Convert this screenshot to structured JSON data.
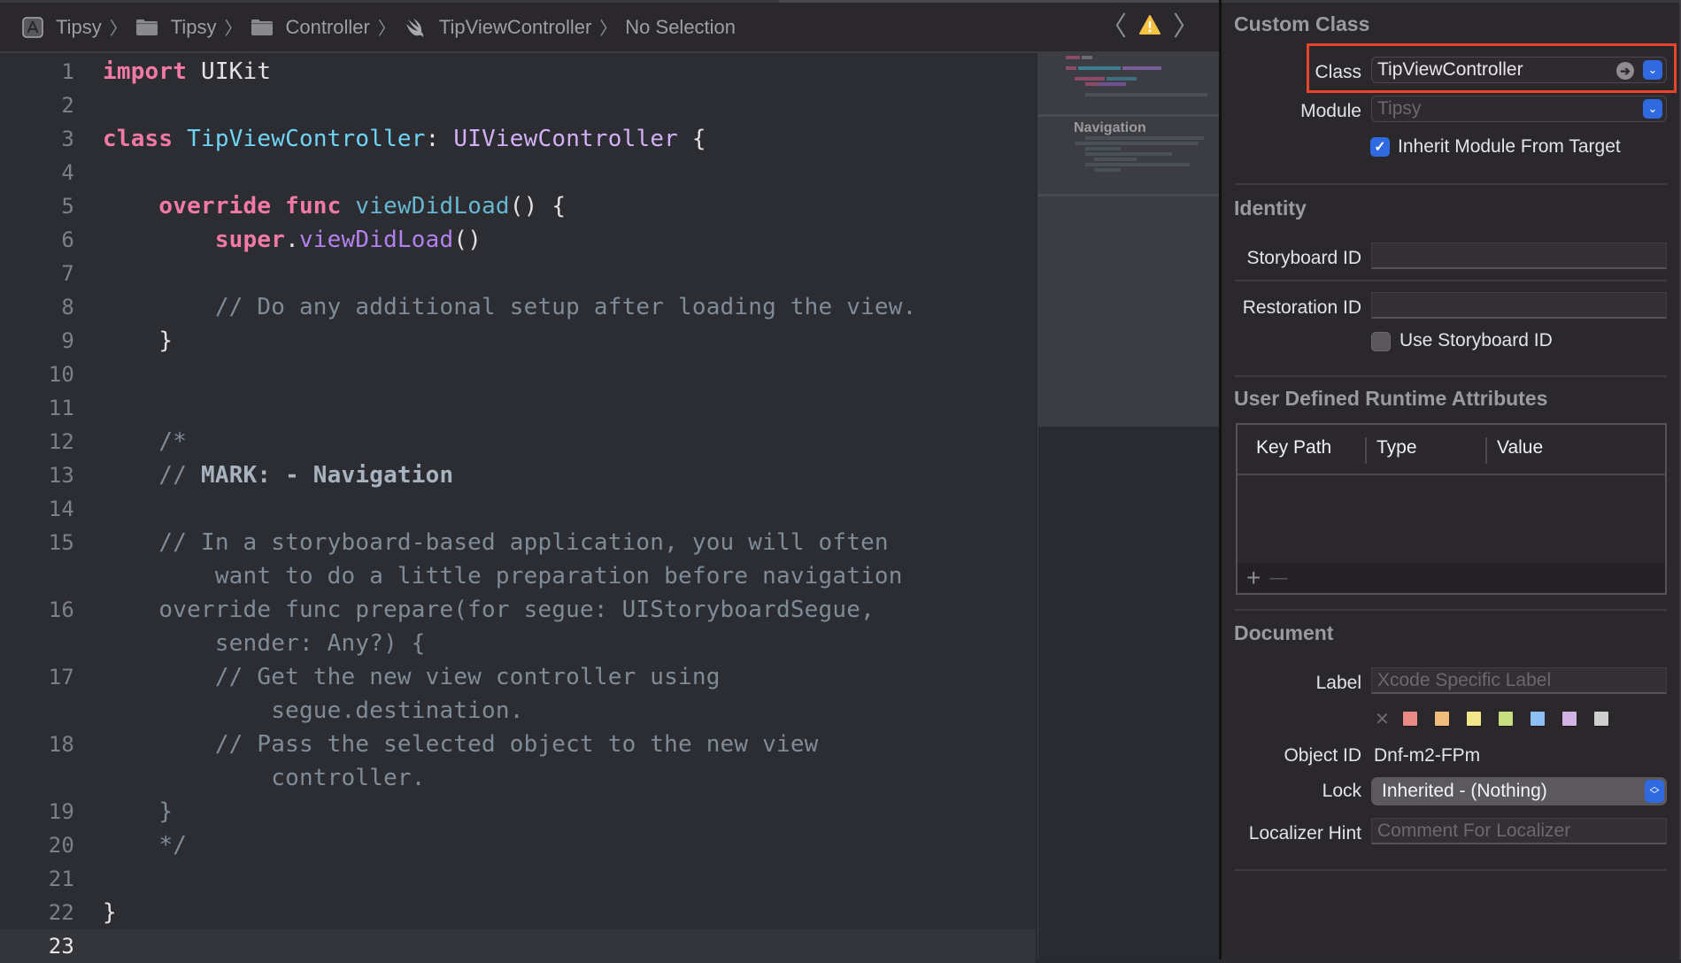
{
  "jumpbar": {
    "crumbs": [
      {
        "label": "Tipsy",
        "icon": "app-project-icon"
      },
      {
        "label": "Tipsy",
        "icon": "folder-icon"
      },
      {
        "label": "Controller",
        "icon": "folder-icon"
      },
      {
        "label": "TipViewController",
        "icon": "swift-file-icon"
      },
      {
        "label": "No Selection",
        "icon": ""
      }
    ],
    "separator": "〉",
    "prev_glyph": "〈",
    "next_glyph": "〉",
    "warning_glyph": "!"
  },
  "editor": {
    "current_line": 23,
    "lines": [
      {
        "n": "1"
      },
      {
        "n": "2"
      },
      {
        "n": "3"
      },
      {
        "n": "4"
      },
      {
        "n": "5"
      },
      {
        "n": "6"
      },
      {
        "n": "7"
      },
      {
        "n": "8"
      },
      {
        "n": "9"
      },
      {
        "n": "10"
      },
      {
        "n": "11"
      },
      {
        "n": "12"
      },
      {
        "n": "13"
      },
      {
        "n": "14"
      },
      {
        "n": "15"
      },
      {
        "n": ""
      },
      {
        "n": "16"
      },
      {
        "n": ""
      },
      {
        "n": "17"
      },
      {
        "n": ""
      },
      {
        "n": "18"
      },
      {
        "n": ""
      },
      {
        "n": "19"
      },
      {
        "n": "20"
      },
      {
        "n": "21"
      },
      {
        "n": "22"
      },
      {
        "n": "23"
      }
    ],
    "tokens": {
      "l1_kw": "import",
      "l1_rest": " UIKit",
      "l3_kw": "class",
      "l3_name": " TipViewController",
      "l3_colon": ": ",
      "l3_super": "UIViewController",
      "l3_brace": " {",
      "l5_kw1": "    override",
      "l5_kw2": " func",
      "l5_fn": " viewDidLoad",
      "l5_rest": "() {",
      "l6_kw": "        super",
      "l6_dot": ".",
      "l6_fn": "viewDidLoad",
      "l6_rest": "()",
      "l8_cm": "        // Do any additional setup after loading the view.",
      "l9": "    }",
      "l12_cm": "    /*",
      "l13_cm": "    // ",
      "l13_mark": "MARK: - Navigation",
      "l15a_cm": "    // In a storyboard-based application, you will often",
      "l15b_cm": "        want to do a little preparation before navigation",
      "l16a_cm": "    override func prepare(for segue: UIStoryboardSegue,",
      "l16b_cm": "        sender: Any?) {",
      "l17a_cm": "        // Get the new view controller using",
      "l17b_cm": "            segue.destination.",
      "l18a_cm": "        // Pass the selected object to the new view",
      "l18b_cm": "            controller.",
      "l19_cm": "    }",
      "l20_cm": "    */",
      "l22": "}"
    }
  },
  "minimap": {
    "section_title": "Navigation"
  },
  "inspector": {
    "custom_class": {
      "title": "Custom Class",
      "class_label": "Class",
      "class_value": "TipViewController",
      "module_label": "Module",
      "module_placeholder": "Tipsy",
      "inherit_label": "Inherit Module From Target",
      "inherit_checked": true
    },
    "identity": {
      "title": "Identity",
      "storyboard_id_label": "Storyboard ID",
      "storyboard_id_value": "",
      "restoration_id_label": "Restoration ID",
      "restoration_id_value": "",
      "use_storyboard_id_label": "Use Storyboard ID",
      "use_storyboard_id_checked": false
    },
    "runtime_attributes": {
      "title": "User Defined Runtime Attributes",
      "columns": [
        "Key Path",
        "Type",
        "Value"
      ],
      "rows": [],
      "add_glyph": "+",
      "remove_glyph": "—"
    },
    "document": {
      "title": "Document",
      "label_label": "Label",
      "label_placeholder": "Xcode Specific Label",
      "clear_glyph": "✕",
      "label_colors": [
        "#e98a87",
        "#efbd7c",
        "#f3e58c",
        "#c7dd7f",
        "#8fc0f5",
        "#d3b3e6",
        "#cfcfcf"
      ],
      "object_id_label": "Object ID",
      "object_id_value": "Dnf-m2-FPm",
      "lock_label": "Lock",
      "lock_value": "Inherited - (Nothing)",
      "localizer_label": "Localizer Hint",
      "localizer_placeholder": "Comment For Localizer"
    }
  },
  "colors": {
    "accent_blue": "#2f6ae0",
    "highlight_red": "#e8452c",
    "warning_yellow": "#f6c244"
  }
}
